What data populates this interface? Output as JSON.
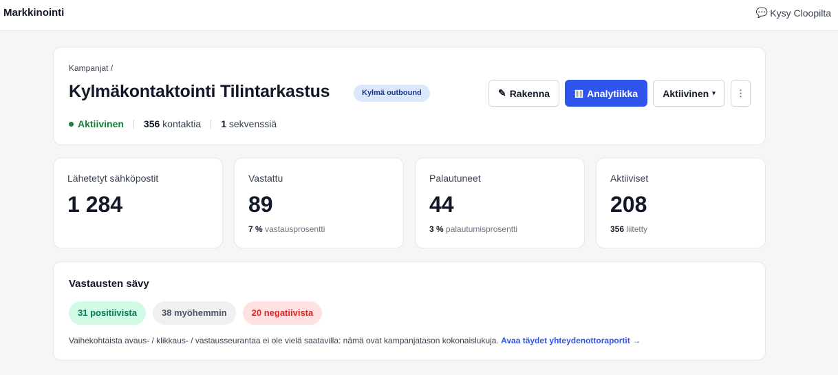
{
  "topbar": {
    "app_title": "Markkinointi",
    "ask_icon": "speech-bubble-icon",
    "ask_label": "Kysy Cloopilta"
  },
  "campaign": {
    "breadcrumb": "Kampanjat",
    "breadcrumb_sep": "/",
    "title": "Kylmäkontaktointi Tilintarkastus",
    "tag": "Kylmä outbound",
    "status": "Aktiivinen",
    "contacts_count": "356",
    "contacts_label": "kontaktia",
    "sequences_count": "1",
    "sequences_label": "sekvenssiä"
  },
  "actions": {
    "build_icon": "✎",
    "build_label": "Rakenna",
    "analytics_icon": "▥",
    "analytics_label": "Analytiikka",
    "status_label": "Aktiivinen",
    "status_caret": "▾",
    "more_icon": "⋮"
  },
  "stats": [
    {
      "label": "Lähetetyt sähköpostit",
      "value": "1 284",
      "sub_value": "",
      "sub_label": ""
    },
    {
      "label": "Vastattu",
      "value": "89",
      "sub_value": "7 %",
      "sub_label": "vastausprosentti"
    },
    {
      "label": "Palautuneet",
      "value": "44",
      "sub_value": "3 %",
      "sub_label": "palautumisprosentti"
    },
    {
      "label": "Aktiiviset",
      "value": "208",
      "sub_value": "356",
      "sub_label": "liitetty"
    }
  ],
  "tone": {
    "title": "Vastausten sävy",
    "positive": "31 positiivista",
    "later": "38 myöhemmin",
    "negative": "20 negatiivista",
    "note": "Vaihekohtaista avaus- / klikkaus- / vastausseurantaa ei ole vielä saatavilla: nämä ovat kampanjatason kokonaislukuja.",
    "link": "Avaa täydet yhteydenottoraportit →"
  },
  "colors": {
    "accent": "#2f54eb",
    "active_green": "#15803d",
    "positive_bg": "#d1fae5",
    "negative_bg": "#fee2e2"
  }
}
